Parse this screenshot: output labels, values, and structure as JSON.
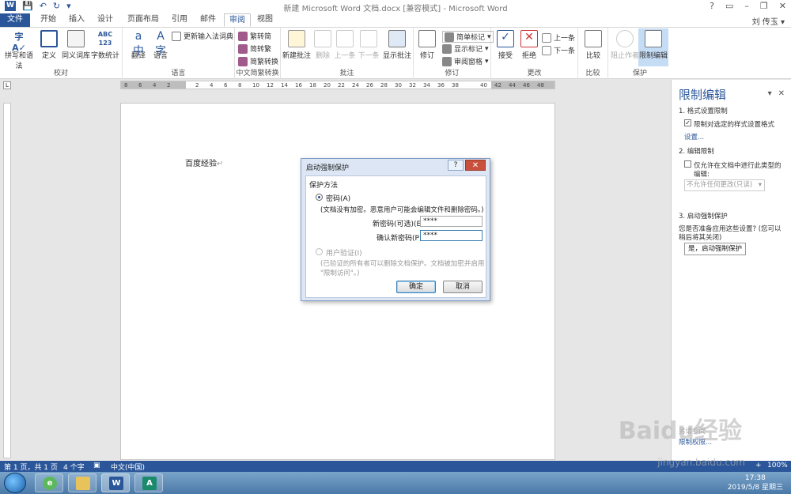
{
  "window": {
    "title": "新建 Microsoft Word 文档.docx [兼容模式] - Microsoft Word",
    "user": "刘 传玉",
    "controls": [
      "?",
      "▭",
      "–",
      "❐",
      "✕"
    ]
  },
  "tabs": [
    "文件",
    "开始",
    "插入",
    "设计",
    "页面布局",
    "引用",
    "邮件",
    "审阅",
    "视图"
  ],
  "active_tab": "审阅",
  "ribbon": {
    "proofing": {
      "label": "校对",
      "spell": "拼写和语法",
      "define": "定义",
      "thesaurus": "同义词库",
      "wordcount": "字数统计"
    },
    "language": {
      "label": "语言",
      "translate": "翻译",
      "language": "语言",
      "ime": "更新输入法词典"
    },
    "chinese": {
      "label": "中文简繁转换",
      "t2s": "繁转简",
      "s2t": "简转繁",
      "convert": "简繁转换"
    },
    "comments": {
      "label": "批注",
      "new": "新建批注",
      "delete": "删除",
      "prev": "上一条",
      "next": "下一条",
      "show": "显示批注"
    },
    "tracking": {
      "label": "修订",
      "track": "修订",
      "markup": "简单标记",
      "show_markup": "显示标记",
      "pane": "审阅窗格"
    },
    "changes": {
      "label": "更改",
      "accept": "接受",
      "reject": "拒绝",
      "prev": "上一条",
      "next": "下一条"
    },
    "compare": {
      "label": "比较",
      "compare": "比较"
    },
    "protect": {
      "label": "保护",
      "block": "阻止作者",
      "restrict": "限制编辑"
    }
  },
  "ruler": {
    "ticks": [
      "8",
      "6",
      "4",
      "2",
      "",
      "2",
      "4",
      "6",
      "8",
      "10",
      "12",
      "14",
      "16",
      "18",
      "20",
      "22",
      "24",
      "26",
      "28",
      "30",
      "32",
      "34",
      "36",
      "38",
      "",
      "40",
      "42",
      "44",
      "46",
      "48"
    ]
  },
  "document": {
    "text": "百度经验"
  },
  "dialog": {
    "title": "启动强制保护",
    "help": "?",
    "close": "✕",
    "group_label": "保护方法",
    "option_password": "密码(A)",
    "password_note": "(文档没有加密。恶意用户可能会编辑文件和删除密码。)",
    "new_password_label": "新密码(可选)(E):",
    "new_password_value": "****",
    "confirm_password_label": "确认新密码(P):",
    "confirm_password_value": "****",
    "option_user_auth": "用户验证(I)",
    "user_auth_note_1": "(已验证的所有者可以删除文档保护。文档被加密并启用",
    "user_auth_note_2": "\"限制访问\"。)",
    "ok": "确定",
    "cancel": "取消"
  },
  "pane": {
    "title": "限制编辑",
    "section1": "1. 格式设置限制",
    "format_checkbox": "限制对选定的样式设置格式",
    "settings_link": "设置...",
    "section2": "2. 编辑限制",
    "edit_checkbox_1": "仅允许在文档中进行此类型的",
    "edit_checkbox_2": "编辑:",
    "edit_dropdown": "不允许任何更改(只读)",
    "section3": "3. 启动强制保护",
    "question_1": "您是否准备应用这些设置? (您可以",
    "question_2": "稍后将其关闭)",
    "start_button": "是，启动强制保护",
    "footer_1": "另请参阅",
    "footer_2": "限制权限..."
  },
  "status": {
    "page": "第 1 页，共 1 页",
    "words": "4 个字",
    "language": "中文(中国)",
    "zoom": "100%"
  },
  "taskbar": {
    "time": "17:38",
    "date": "2019/5/8 星期三"
  },
  "watermark": {
    "main": "Baidu经验",
    "url": "jingyan.baidu.com"
  }
}
